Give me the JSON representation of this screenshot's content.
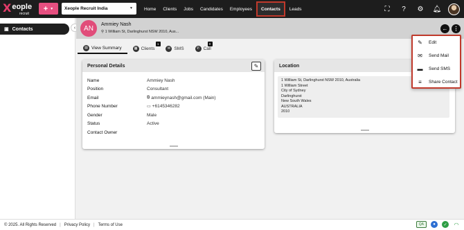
{
  "topbar": {
    "logo_text": "Xeople",
    "logo_sub": "recruit",
    "plus_label": "+",
    "org_select_value": "Xeople Recruit India",
    "nav": [
      "Home",
      "Clients",
      "Jobs",
      "Candidates",
      "Employees",
      "Contacts",
      "Leads"
    ],
    "active_nav": "Contacts",
    "icons": [
      "fullscreen-icon",
      "help-icon",
      "settings-icon",
      "bell-icon",
      "user-avatar"
    ]
  },
  "sidebar": {
    "items": [
      {
        "label": "Contacts",
        "icon": "contacts-icon"
      }
    ]
  },
  "contact": {
    "initials": "AN",
    "name": "Ammiey Nash",
    "address_short": "1 William St, Darlinghurst NSW 2010, Aus..."
  },
  "tabs": [
    {
      "label": "View Summary",
      "icon": "summary-icon",
      "badge": ""
    },
    {
      "label": "Clients",
      "icon": "clients-icon",
      "badge": "1"
    },
    {
      "label": "SMS",
      "icon": "sms-icon",
      "badge": ""
    },
    {
      "label": "Call",
      "icon": "call-icon",
      "badge": "0"
    }
  ],
  "personal_details": {
    "title": "Personal Details",
    "rows": [
      {
        "label": "Name",
        "value": "Ammiey Nash"
      },
      {
        "label": "Position",
        "value": "Consultant"
      },
      {
        "label": "Email",
        "value": "ammieynash@gmail.com (Main)"
      },
      {
        "label": "Phone Number",
        "value": "+6145346282"
      },
      {
        "label": "Gender",
        "value": "Male"
      },
      {
        "label": "Status",
        "value": "Active"
      },
      {
        "label": "Contact Owner",
        "value": ""
      }
    ]
  },
  "location": {
    "title": "Location",
    "lines": [
      "1 William St, Darlinghurst NSW 2010, Australia",
      "1 William Street",
      "City of Sydney",
      "Darlinghurst",
      "New South Wales",
      "AUSTRALIA",
      "2010"
    ]
  },
  "menu": {
    "items": [
      {
        "label": "Edit",
        "icon": "pencil-icon"
      },
      {
        "label": "Send Mail",
        "icon": "mail-icon"
      },
      {
        "label": "Send SMS",
        "icon": "sms-icon"
      },
      {
        "label": "Share Contact",
        "icon": "share-icon"
      }
    ]
  },
  "footer": {
    "copyright": "© 2025. All Rights Reserved",
    "privacy": "Privacy Policy",
    "terms": "Terms of Use",
    "env_badge": "QA"
  },
  "colors": {
    "accent": "#e64f80",
    "topbar_bg": "#1d1d1d",
    "highlight_border": "#c0392b"
  }
}
